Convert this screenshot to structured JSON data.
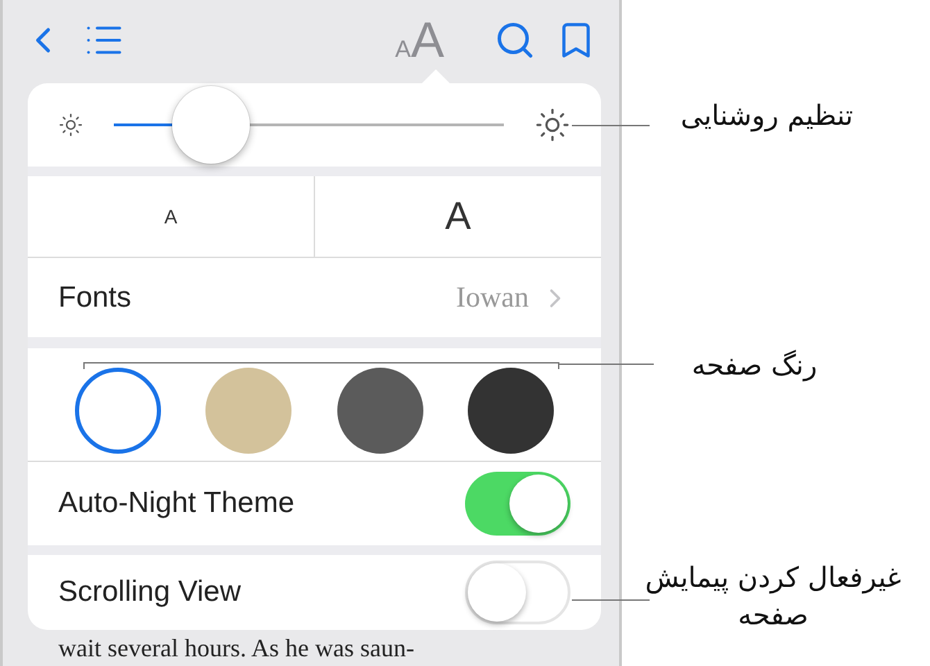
{
  "toolbar": {
    "font_button": {
      "small": "A",
      "large": "A"
    }
  },
  "brightness": {
    "level": 0.25
  },
  "font_size": {
    "smaller": "A",
    "larger": "A"
  },
  "fonts": {
    "label": "Fonts",
    "value": "Iowan"
  },
  "themes": [
    {
      "color": "#ffffff",
      "selected": true
    },
    {
      "color": "#d3c29b",
      "selected": false
    },
    {
      "color": "#5b5b5b",
      "selected": false
    },
    {
      "color": "#333333",
      "selected": false
    }
  ],
  "toggles": [
    {
      "label": "Auto-Night Theme",
      "on": true
    },
    {
      "label": "Scrolling View",
      "on": false
    }
  ],
  "page_text": "wait several hours. As he was saun-",
  "annotations": [
    {
      "kind": "brightness",
      "text": "تنظیم روشنایی"
    },
    {
      "kind": "theme",
      "text": "رنگ صفحه"
    },
    {
      "kind": "scroll",
      "text": "غیرفعال کردن پیمایش صفحه"
    }
  ]
}
